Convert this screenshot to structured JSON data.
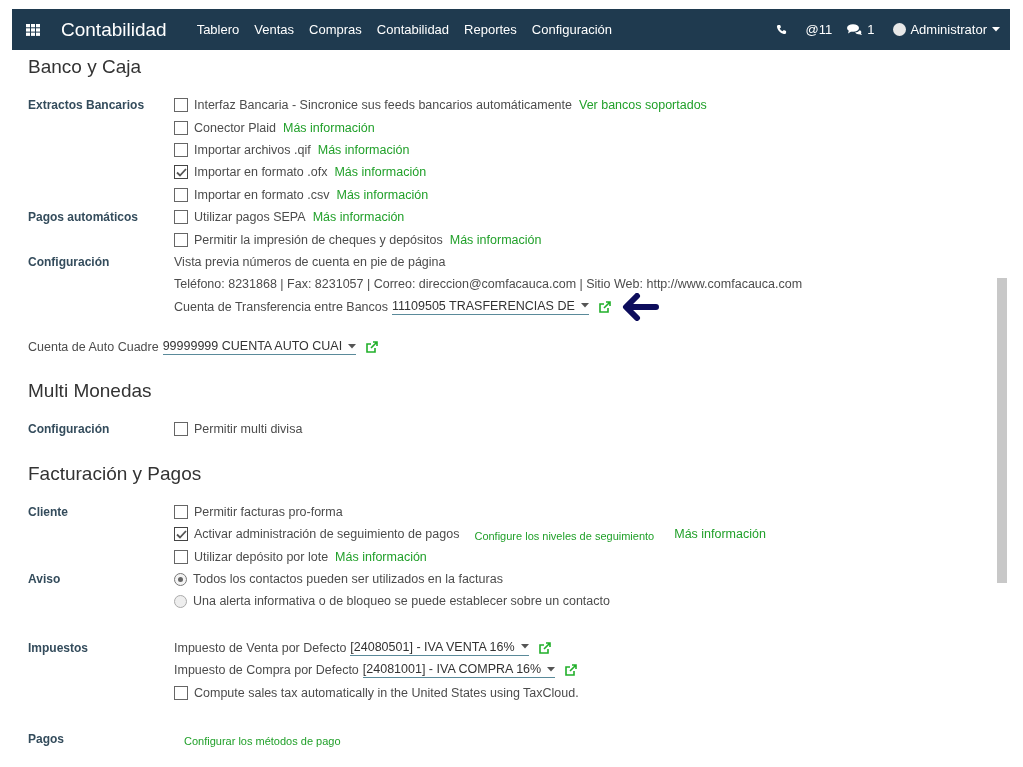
{
  "navbar": {
    "brand": "Contabilidad",
    "menu": [
      "Tablero",
      "Ventas",
      "Compras",
      "Contabilidad",
      "Reportes",
      "Configuración"
    ],
    "mentions": "@11",
    "messages": "1",
    "user": "Administrator"
  },
  "sections": [
    {
      "title": "Banco y Caja",
      "rows": [
        {
          "kind": "labeled",
          "label": "Extractos Bancarios",
          "items": [
            {
              "kind": "checkbox",
              "label": "Interfaz Bancaria - Sincronice sus feeds bancarios automáticamente",
              "checked": false,
              "links": [
                {
                  "text": "Ver bancos soportados",
                  "small": false
                }
              ]
            },
            {
              "kind": "checkbox",
              "label": "Conector Plaid",
              "checked": false,
              "links": [
                {
                  "text": "Más información",
                  "small": false
                }
              ]
            },
            {
              "kind": "checkbox",
              "label": "Importar archivos .qif",
              "checked": false,
              "links": [
                {
                  "text": "Más información",
                  "small": false
                }
              ]
            },
            {
              "kind": "checkbox",
              "label": "Importar en formato .ofx",
              "checked": true,
              "links": [
                {
                  "text": "Más información",
                  "small": false
                }
              ]
            },
            {
              "kind": "checkbox",
              "label": "Importar en formato .csv",
              "checked": false,
              "links": [
                {
                  "text": "Más información",
                  "small": false
                }
              ]
            }
          ]
        },
        {
          "kind": "labeled",
          "label": "Pagos automáticos",
          "items": [
            {
              "kind": "checkbox",
              "label": "Utilizar pagos SEPA",
              "checked": false,
              "links": [
                {
                  "text": "Más información",
                  "small": false
                }
              ]
            },
            {
              "kind": "checkbox",
              "label": "Permitir la impresión de cheques y depósitos",
              "checked": false,
              "links": [
                {
                  "text": "Más información",
                  "small": false
                }
              ]
            }
          ]
        },
        {
          "kind": "labeled",
          "label": "Configuración",
          "items": [
            {
              "kind": "text",
              "text": "Vista previa números de cuenta en pie de página"
            },
            {
              "kind": "text",
              "text": "Teléfono: 8231868 | Fax: 8231057 | Correo: direccion@comfacauca.com | Sitio Web: http://www.comfacauca.com"
            },
            {
              "kind": "select",
              "label": "Cuenta de Transferencia entre Bancos",
              "value": "11109505 TRASFERENCIAS DE",
              "pointer": true
            }
          ]
        },
        {
          "kind": "full",
          "items": [
            {
              "kind": "select",
              "label": "Cuenta de Auto Cuadre",
              "value": "99999999 CUENTA AUTO CUAI"
            }
          ]
        }
      ]
    },
    {
      "title": "Multi Monedas",
      "rows": [
        {
          "kind": "labeled",
          "label": "Configuración",
          "items": [
            {
              "kind": "checkbox",
              "label": "Permitir multi divisa",
              "checked": false
            }
          ]
        }
      ]
    },
    {
      "title": "Facturación y Pagos",
      "rows": [
        {
          "kind": "labeled",
          "label": "Cliente",
          "items": [
            {
              "kind": "checkbox",
              "label": "Permitir facturas pro-forma",
              "checked": false
            },
            {
              "kind": "checkbox",
              "label": "Activar administración de seguimiento de pagos",
              "checked": true,
              "links": [
                {
                  "text": "Configure los niveles de seguimiento",
                  "small": true
                },
                {
                  "text": "Más información",
                  "small": false
                }
              ]
            },
            {
              "kind": "checkbox",
              "label": "Utilizar depósito por lote",
              "checked": false,
              "links": [
                {
                  "text": "Más información",
                  "small": false
                }
              ]
            }
          ]
        },
        {
          "kind": "labeled",
          "label": "Aviso",
          "items": [
            {
              "kind": "radio",
              "label": "Todos los contactos pueden ser utilizados en la facturas",
              "selected": true
            },
            {
              "kind": "radio",
              "label": "Una alerta informativa o de bloqueo se puede establecer sobre un contacto",
              "selected": false
            }
          ]
        },
        {
          "kind": "labeled",
          "label": "Impuestos",
          "items": [
            {
              "kind": "select",
              "label": "Impuesto de Venta por Defecto",
              "value": "[24080501] - IVA VENTA 16%"
            },
            {
              "kind": "select",
              "label": "Impuesto de Compra por Defecto",
              "value": "[24081001] - IVA COMPRA 16%"
            },
            {
              "kind": "checkbox",
              "label": "Compute sales tax automatically in the United States using TaxCloud.",
              "checked": false
            }
          ]
        },
        {
          "kind": "labeled",
          "label": "Pagos",
          "items": [
            {
              "kind": "link",
              "text": "Configurar los métodos de pago"
            }
          ]
        }
      ]
    }
  ]
}
